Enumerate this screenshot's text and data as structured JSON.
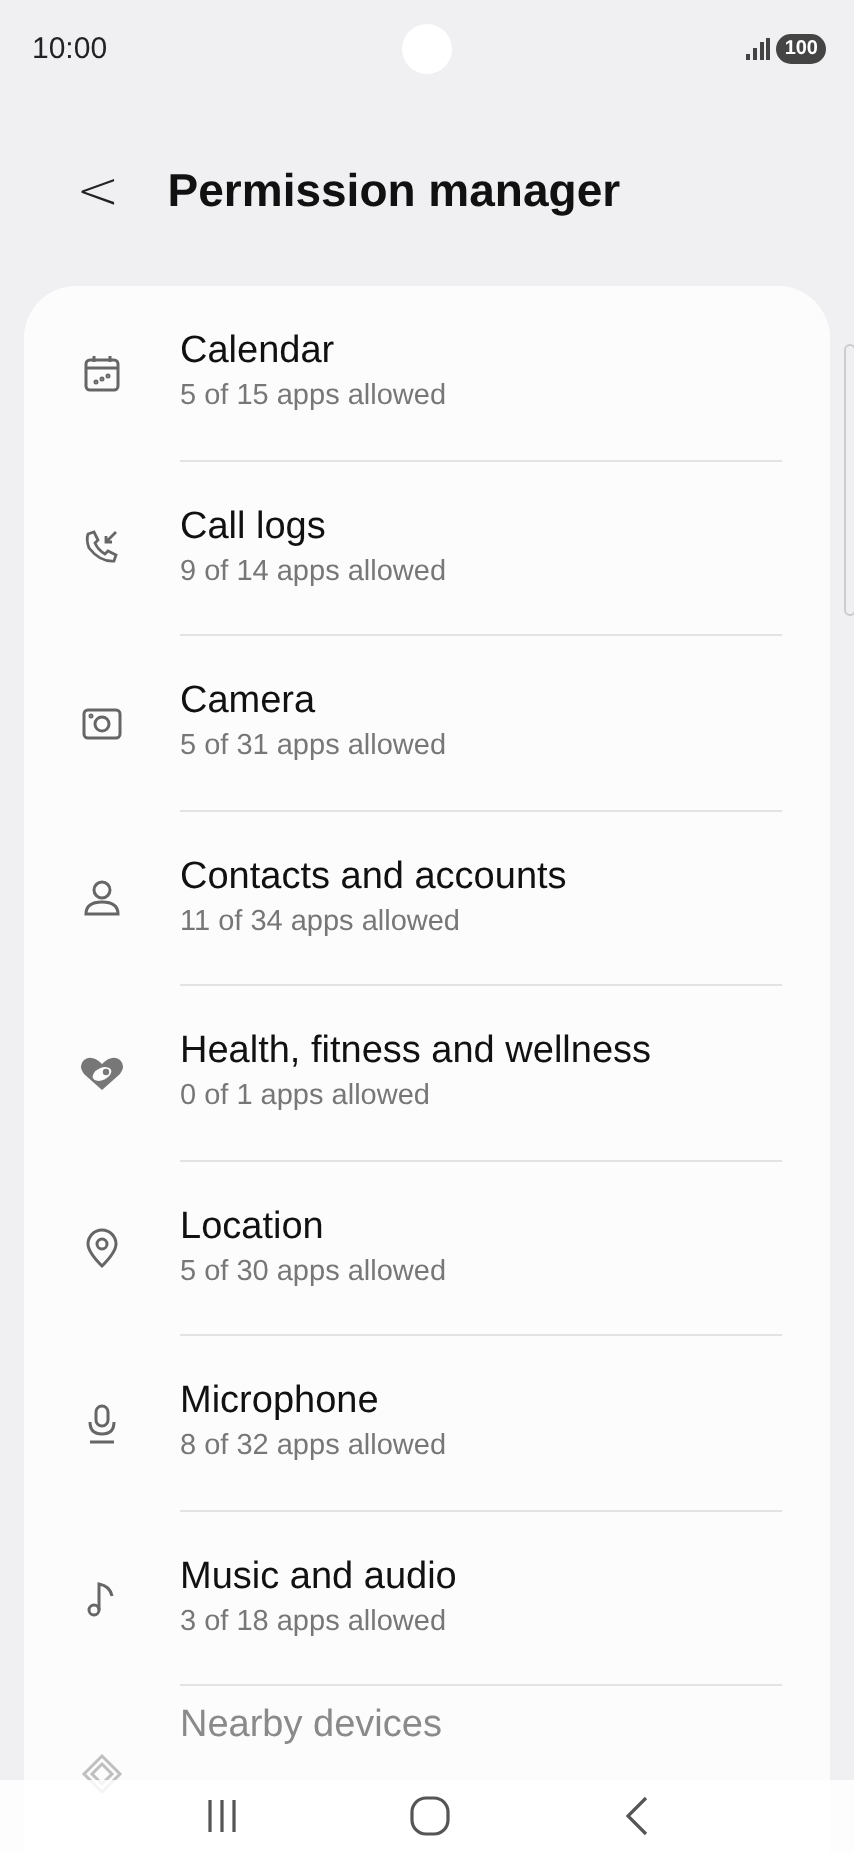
{
  "status_bar": {
    "time": "10:00",
    "battery": "100"
  },
  "header": {
    "back": "<",
    "title": "Permission manager"
  },
  "permissions": [
    {
      "kind": "calendar",
      "title": "Calendar",
      "subtitle": "5 of 15 apps allowed"
    },
    {
      "kind": "call",
      "title": "Call logs",
      "subtitle": "9 of 14 apps allowed"
    },
    {
      "kind": "camera",
      "title": "Camera",
      "subtitle": "5 of 31 apps allowed"
    },
    {
      "kind": "person",
      "title": "Contacts and accounts",
      "subtitle": "11 of 34 apps allowed"
    },
    {
      "kind": "heart",
      "title": "Health, fitness and wellness",
      "subtitle": "0 of 1 apps allowed"
    },
    {
      "kind": "pin",
      "title": "Location",
      "subtitle": "5 of 30 apps allowed"
    },
    {
      "kind": "mic",
      "title": "Microphone",
      "subtitle": "8 of 32 apps allowed"
    },
    {
      "kind": "note",
      "title": "Music and audio",
      "subtitle": "3 of 18 apps allowed"
    },
    {
      "kind": "diamond",
      "title": "Nearby devices"
    }
  ]
}
